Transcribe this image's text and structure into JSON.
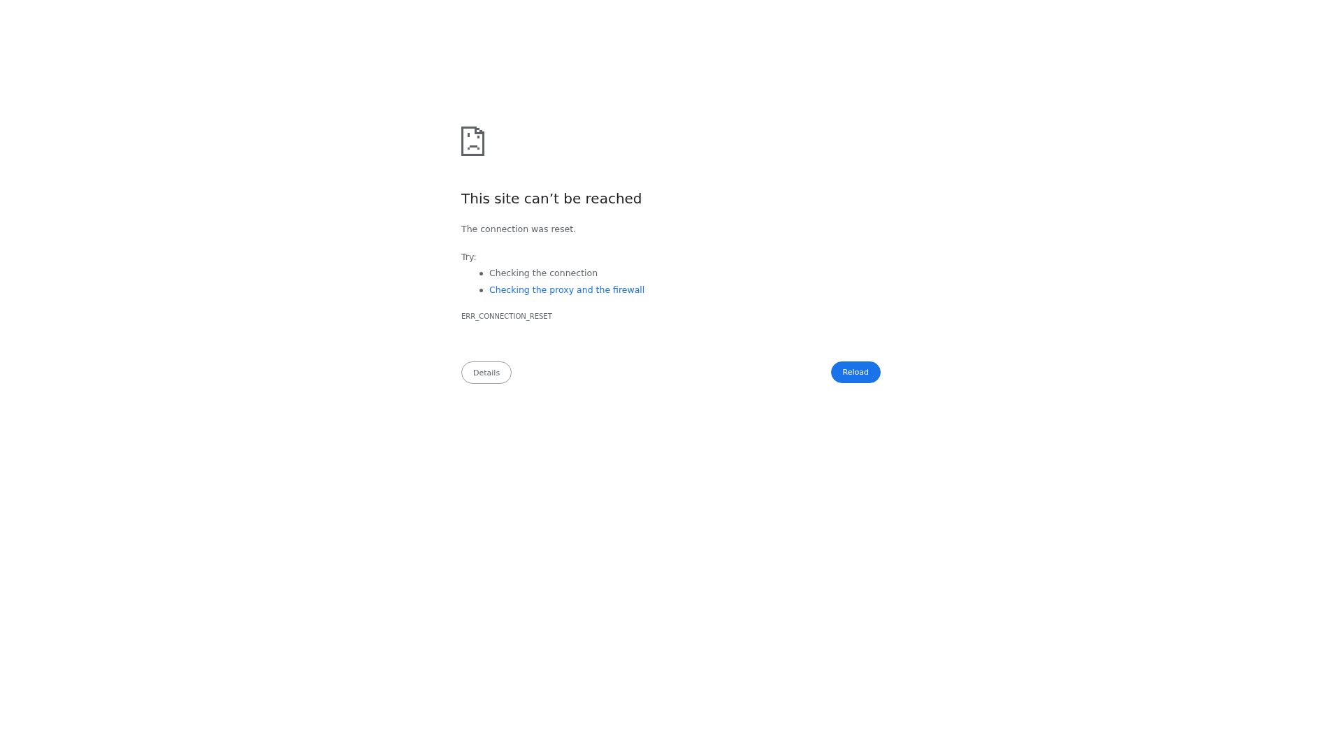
{
  "heading": "This site can’t be reached",
  "summary": "The connection was reset.",
  "suggestions": {
    "label": "Try:",
    "items": [
      {
        "text": "Checking the connection",
        "kind": "text"
      },
      {
        "text": "Checking the proxy and the firewall",
        "kind": "link"
      }
    ]
  },
  "error_code": "ERR_CONNECTION_RESET",
  "buttons": [
    {
      "label": "Details",
      "kind": "secondary"
    },
    {
      "label": "Reload",
      "kind": "primary"
    }
  ]
}
